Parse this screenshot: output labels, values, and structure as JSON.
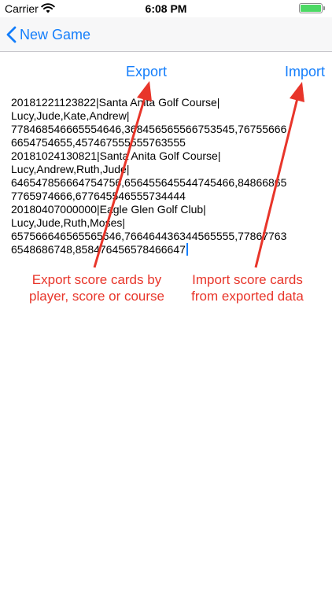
{
  "status_bar": {
    "carrier": "Carrier",
    "time": "6:08 PM",
    "battery_level": 1.0,
    "battery_color": "#4cd964"
  },
  "nav": {
    "back_label": "New Game",
    "back_icon": "chevron-left-icon",
    "accent_color": "#147efb"
  },
  "toolbar": {
    "export_label": "Export",
    "import_label": "Import"
  },
  "editor": {
    "lines": [
      "20181221123822|Santa Anita Golf Course|",
      "Lucy,Jude,Kate,Andrew|",
      "778468546665554646,368456565566753545,76755666",
      "6654754655,457467555555763555",
      "20181024130821|Santa Anita Golf Course|",
      "Lucy,Andrew,Ruth,Jude|",
      "646547856664754756,656455645544745466,84866865",
      "7765974666,677645546555734444",
      "20180407000000|Eagle Glen Golf Club|",
      "Lucy,Jude,Ruth,Moses|",
      "657566646565565646,766464436344565555,77867763",
      "6548686748,858476456578466647"
    ]
  },
  "annotations": {
    "export_callout": [
      "Export score cards by",
      "player, score or course"
    ],
    "import_callout": [
      "Import score cards",
      "from exported data"
    ],
    "color": "#e8352a"
  }
}
